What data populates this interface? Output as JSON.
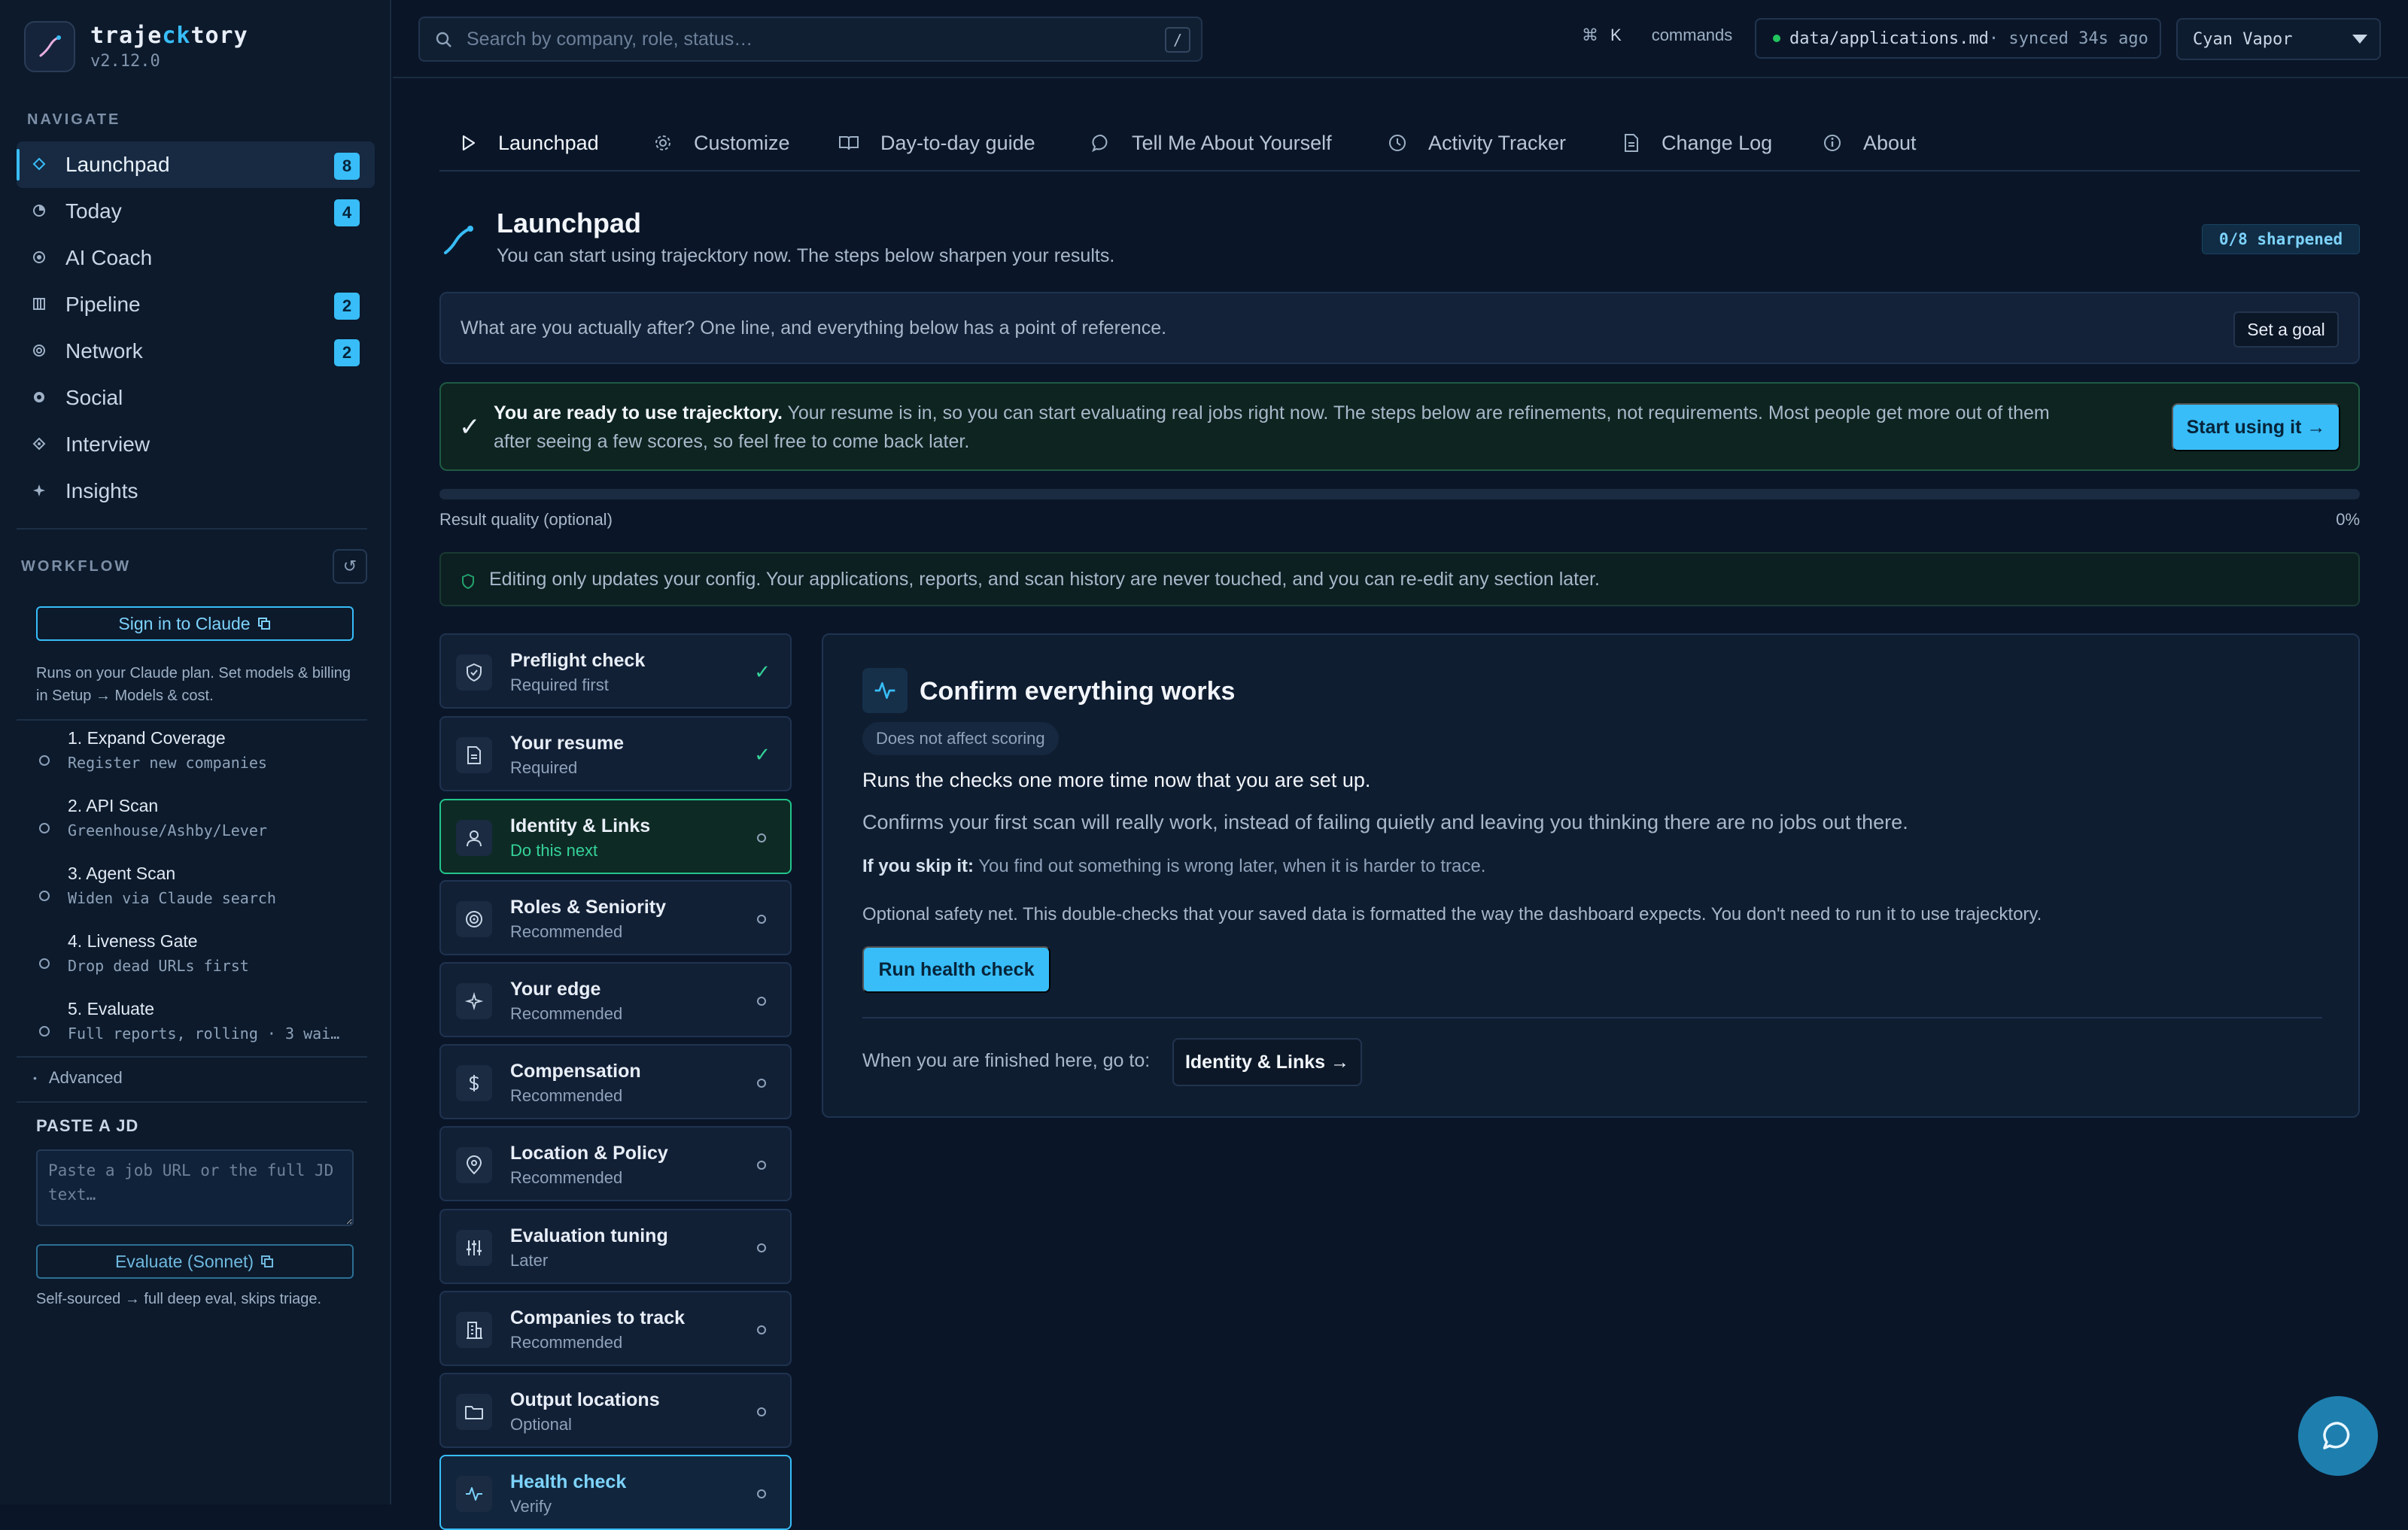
{
  "brand": {
    "name_a": "traje",
    "name_b": "ck",
    "name_c": "tory",
    "version": "v2.12.0"
  },
  "sidebar": {
    "navigate_header": "NAVIGATE",
    "nav": [
      {
        "label": "Launchpad",
        "badge": "8",
        "icon": "diamond-icon"
      },
      {
        "label": "Today",
        "badge": "4",
        "icon": "clock-icon"
      },
      {
        "label": "AI Coach",
        "badge": "",
        "icon": "target-icon"
      },
      {
        "label": "Pipeline",
        "badge": "2",
        "icon": "columns-icon"
      },
      {
        "label": "Network",
        "badge": "2",
        "icon": "ring-icon"
      },
      {
        "label": "Social",
        "badge": "",
        "icon": "circle-icon"
      },
      {
        "label": "Interview",
        "badge": "",
        "icon": "diamond-outline-icon"
      },
      {
        "label": "Insights",
        "badge": "",
        "icon": "sparkle-icon"
      }
    ],
    "workflow_header": "WORKFLOW",
    "sign_in_label": "Sign in to Claude",
    "plan_note": "Runs on your Claude plan. Set models & billing in Setup → Models & cost.",
    "workflow": [
      {
        "title": "1. Expand Coverage",
        "sub": "Register new companies"
      },
      {
        "title": "2. API Scan",
        "sub": "Greenhouse/Ashby/Lever"
      },
      {
        "title": "3. Agent Scan",
        "sub": "Widen via Claude search"
      },
      {
        "title": "4. Liveness Gate",
        "sub": "Drop dead URLs first"
      },
      {
        "title": "5. Evaluate",
        "sub": "Full reports, rolling · 3 wai…"
      }
    ],
    "advanced_label": "Advanced",
    "jd_header": "PASTE A JD",
    "jd_placeholder": "Paste a job URL or the full JD text…",
    "evaluate_label": "Evaluate (Sonnet)",
    "jd_note": "Self-sourced → full deep eval, skips triage."
  },
  "topbar": {
    "search_placeholder": "Search by company, role, status…",
    "search_shortcut": "/",
    "cmd_key": "⌘",
    "cmd_k": "K",
    "cmd_label": "commands",
    "sync_file": "data/applications.md",
    "sync_status": " · synced 34s ago",
    "theme": "Cyan Vapor"
  },
  "tabs": [
    {
      "label": "Launchpad",
      "icon": "play-icon"
    },
    {
      "label": "Customize",
      "icon": "gear-icon"
    },
    {
      "label": "Day-to-day guide",
      "icon": "book-icon"
    },
    {
      "label": "Tell Me About Yourself",
      "icon": "chat-bubble-icon"
    },
    {
      "label": "Activity Tracker",
      "icon": "clock-icon"
    },
    {
      "label": "Change Log",
      "icon": "document-icon"
    },
    {
      "label": "About",
      "icon": "info-icon"
    }
  ],
  "header": {
    "title": "Launchpad",
    "subtitle": "You can start using trajecktory now. The steps below sharpen your results.",
    "sharpened": "0/8 sharpened"
  },
  "goal": {
    "prompt": "What are you actually after? One line, and everything below has a point of reference.",
    "button": "Set a goal"
  },
  "ready": {
    "check": "✓",
    "bold": "You are ready to use trajecktory.",
    "text": " Your resume is in, so you can start evaluating real jobs right now. The steps below are refinements, not requirements. Most people get more out of them after seeing a few scores, so feel free to come back later.",
    "button": "Start using it →"
  },
  "quality": {
    "label": "Result quality (optional)",
    "percent": "0%",
    "fraction": 0
  },
  "info": {
    "text": "Editing only updates your config. Your applications, reports, and scan history are never touched, and you can re-edit any section later."
  },
  "steps": [
    {
      "title": "Preflight check",
      "sub": "Required first",
      "status": "✓",
      "state": "done",
      "icon": "shield-icon"
    },
    {
      "title": "Your resume",
      "sub": "Required",
      "status": "✓",
      "state": "done",
      "icon": "file-icon"
    },
    {
      "title": "Identity & Links",
      "sub": "Do this next",
      "status": "",
      "state": "next",
      "icon": "user-icon"
    },
    {
      "title": "Roles & Seniority",
      "sub": "Recommended",
      "status": "",
      "state": "todo",
      "icon": "target-icon"
    },
    {
      "title": "Your edge",
      "sub": "Recommended",
      "status": "",
      "state": "todo",
      "icon": "sparkle-icon"
    },
    {
      "title": "Compensation",
      "sub": "Recommended",
      "status": "",
      "state": "todo",
      "icon": "dollar-icon"
    },
    {
      "title": "Location & Policy",
      "sub": "Recommended",
      "status": "",
      "state": "todo",
      "icon": "pin-icon"
    },
    {
      "title": "Evaluation tuning",
      "sub": "Later",
      "status": "",
      "state": "todo",
      "icon": "sliders-icon"
    },
    {
      "title": "Companies to track",
      "sub": "Recommended",
      "status": "",
      "state": "todo",
      "icon": "building-icon"
    },
    {
      "title": "Output locations",
      "sub": "Optional",
      "status": "",
      "state": "todo",
      "icon": "folder-icon"
    },
    {
      "title": "Health check",
      "sub": "Verify",
      "status": "",
      "state": "current",
      "icon": "pulse-icon"
    }
  ],
  "panel": {
    "title": "Confirm everything works",
    "badge": "Does not affect scoring",
    "lead": "Runs the checks one more time now that you are set up.",
    "desc": "Confirms your first scan will really work, instead of failing quietly and leaving you thinking there are no jobs out there.",
    "skip_label": "If you skip it:",
    "skip_text": " You find out something is wrong later, when it is harder to trace.",
    "note": "Optional safety net. This double-checks that your saved data is formatted the way the dashboard expects. You don't need to run it to use trajecktory.",
    "run_button": "Run health check",
    "next_label": "When you are finished here, go to:",
    "next_button": "Identity & Links →"
  },
  "colors": {
    "accent": "#38bdf8",
    "success": "#34d399",
    "bg": "#0a1628"
  }
}
